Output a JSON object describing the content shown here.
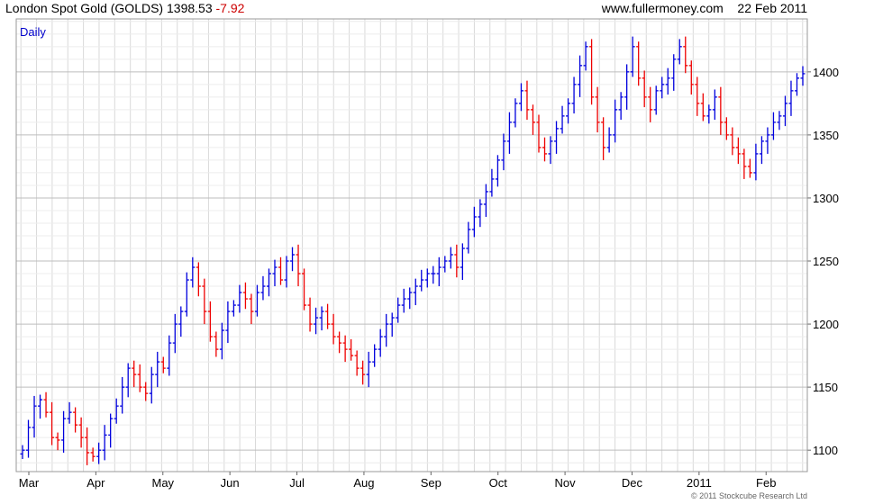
{
  "header": {
    "name": "London Spot Gold (GOLDS)",
    "price": "1398.53",
    "change": "-7.92",
    "site": "www.fullermoney.com",
    "date": "22 Feb 2011"
  },
  "footer": {
    "copyright": "© 2011 Stockcube Research Ltd"
  },
  "colors": {
    "up": "#0000dd",
    "down": "#ee0000",
    "grid": "#d9d9d9",
    "frame": "#999999",
    "period": "#0000cc"
  },
  "chart_data": {
    "type": "line",
    "title": "London Spot Gold (GOLDS) 1398.53 -7.92",
    "period_label": "Daily",
    "ylim": [
      1083,
      1442
    ],
    "yticks": [
      1100,
      1150,
      1200,
      1250,
      1300,
      1350,
      1400
    ],
    "x_tick_labels": [
      "Mar",
      "Apr",
      "May",
      "Jun",
      "Jul",
      "Aug",
      "Sep",
      "Oct",
      "Nov",
      "Dec",
      "2011",
      "Feb"
    ],
    "x_minor_weeks": 50,
    "grid": true,
    "series": [
      {
        "values": [
          1100,
          1118,
          1135,
          1140,
          1130,
          1110,
          1108,
          1125,
          1130,
          1120,
          1110,
          1098,
          1095,
          1100,
          1112,
          1125,
          1135,
          1150,
          1165,
          1160,
          1150,
          1145,
          1160,
          1170,
          1165,
          1185,
          1200,
          1210,
          1235,
          1245,
          1230,
          1210,
          1190,
          1180,
          1195,
          1210,
          1215,
          1225,
          1220,
          1210,
          1225,
          1230,
          1240,
          1245,
          1235,
          1250,
          1255,
          1240,
          1215,
          1200,
          1205,
          1210,
          1200,
          1190,
          1185,
          1180,
          1175,
          1165,
          1160,
          1170,
          1180,
          1190,
          1200,
          1205,
          1215,
          1220,
          1225,
          1230,
          1235,
          1240,
          1240,
          1245,
          1250,
          1255,
          1245,
          1260,
          1275,
          1285,
          1295,
          1305,
          1315,
          1330,
          1345,
          1360,
          1375,
          1385,
          1370,
          1360,
          1340,
          1335,
          1345,
          1355,
          1365,
          1375,
          1390,
          1405,
          1420,
          1380,
          1360,
          1340,
          1350,
          1370,
          1380,
          1400,
          1420,
          1395,
          1380,
          1370,
          1385,
          1390,
          1395,
          1410,
          1420,
          1405,
          1390,
          1375,
          1365,
          1370,
          1380,
          1360,
          1350,
          1340,
          1335,
          1325,
          1320,
          1335,
          1345,
          1350,
          1360,
          1365,
          1375,
          1385,
          1395,
          1398.53
        ]
      }
    ]
  }
}
